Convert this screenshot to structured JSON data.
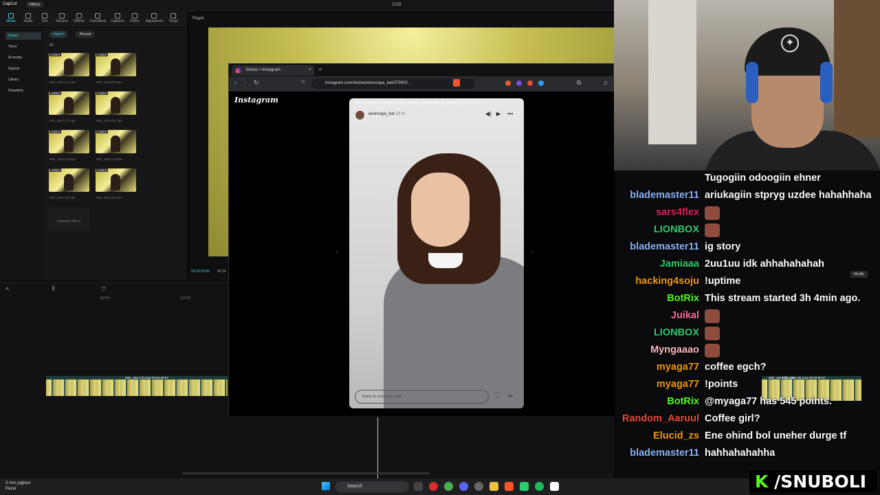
{
  "capcut": {
    "app_name": "CapCut",
    "menu_label": "Menu",
    "project_title": "1218",
    "toolbar": [
      "Media",
      "Audio",
      "Text",
      "Stickers",
      "Effects",
      "Transitions",
      "Captions",
      "Filters",
      "Adjustment",
      "Templ"
    ],
    "left_nav": [
      "Import",
      "Yours",
      "AI media",
      "Spaces",
      "Library",
      "Dreamina"
    ],
    "import_label": "Import",
    "record_label": "Record",
    "all_label": "All",
    "added_label": "Added",
    "clips": [
      "IMG_1944 (1).mp4",
      "IMG_1944 (8).mp4",
      "IMG_1944 (7).mp4",
      "IMG_1944 (6).mp4",
      "IMG_1944 (5).mp4",
      "IMG_1944 (4).mp4",
      "IMG_1944 (3).mp4",
      "IMG_1944 (2).mp4"
    ],
    "generate_label": "Generate with AI",
    "player_label": "Player",
    "player_time": "00:19:10:00",
    "player_time2": "00:34",
    "ruler": [
      "|00:00",
      "|10:00"
    ],
    "timeline_clip": "IMG_1944 (3).mp4  00:04:38:07",
    "side_clip_1": "IMG_1944 (2).mp4",
    "side_clip_2": "IMG_1944 (8).mp4  00:02:09:27",
    "modify_label": "Modify"
  },
  "browser": {
    "tab_title": "Stories • Instagram",
    "url": "instagram.com/stories/ariunzaya_bat/379003...",
    "logo": "Instagram",
    "story_user": "ariunzaya_bat",
    "story_time": "23 m",
    "reply_placeholder": "Reply to ariunzaya_bat..."
  },
  "chat": [
    {
      "user": "",
      "user_color": "#ffffff",
      "message": "Tugogiin odoogiin ehner",
      "emote": false
    },
    {
      "user": "blademaster11",
      "user_color": "#8ab4f8",
      "message": "ariukagiin stpryg uzdee hahahhaha",
      "emote": false
    },
    {
      "user": "sars4flex",
      "user_color": "#e0245e",
      "message": "",
      "emote": true
    },
    {
      "user": "LIONBOX",
      "user_color": "#2ecc71",
      "message": "",
      "emote": true
    },
    {
      "user": "blademaster11",
      "user_color": "#8ab4f8",
      "message": "ig story",
      "emote": false
    },
    {
      "user": "Jamiaaa",
      "user_color": "#2ecc71",
      "message": "2uu1uu idk ahhahahahah",
      "emote": false
    },
    {
      "user": "hacking4soju",
      "user_color": "#f39c12",
      "message": "!uptime",
      "emote": false
    },
    {
      "user": "BotRix",
      "user_color": "#53fc18",
      "message": "This stream started 3h 4min ago.",
      "emote": false
    },
    {
      "user": "Juikal",
      "user_color": "#ff6b9d",
      "message": "",
      "emote": true
    },
    {
      "user": "LIONBOX",
      "user_color": "#2ecc71",
      "message": "",
      "emote": true
    },
    {
      "user": "Myngaaao",
      "user_color": "#ffb6c1",
      "message": "",
      "emote": true
    },
    {
      "user": "myaga77",
      "user_color": "#f39c12",
      "message": "coffee egch?",
      "emote": false
    },
    {
      "user": "myaga77",
      "user_color": "#f39c12",
      "message": "!points",
      "emote": false
    },
    {
      "user": "BotRix",
      "user_color": "#53fc18",
      "message": "@myaga77 has 545 points.",
      "emote": false
    },
    {
      "user": "Random_Aaruul",
      "user_color": "#e74c3c",
      "message": "Coffee girl?",
      "emote": false
    },
    {
      "user": "Elucid_zs",
      "user_color": "#f39c12",
      "message": "Ene ohind bol uneher durge tf",
      "emote": false
    },
    {
      "user": "blademaster11",
      "user_color": "#8ab4f8",
      "message": "hahhahahahha",
      "emote": false
    }
  ],
  "brand": {
    "k": "K",
    "name": "/SNUBOLI"
  },
  "taskbar": {
    "weather_temp": "3 mm yağmur",
    "weather_day": "Pazar",
    "search_label": "Search"
  }
}
